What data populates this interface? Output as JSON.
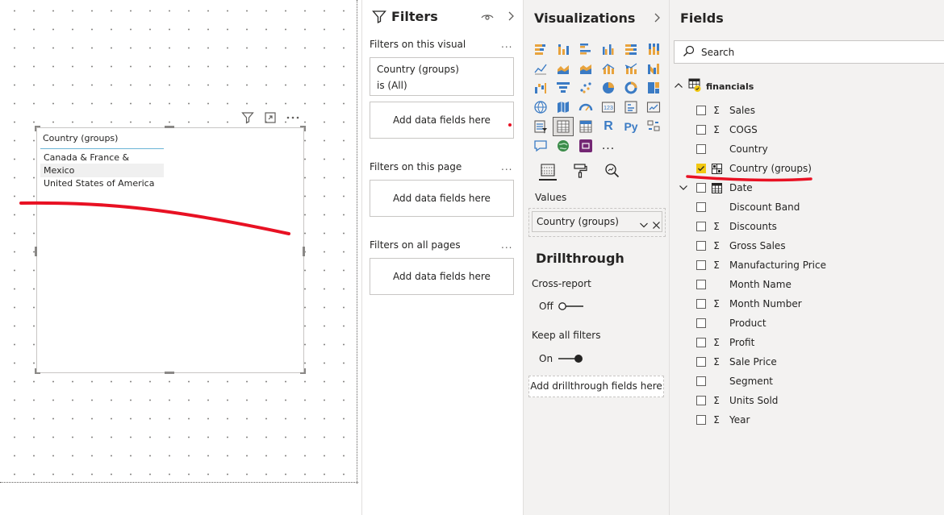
{
  "colors": {
    "accent_yellow": "#f2c811",
    "annotation_red": "#e81123",
    "pane_bg": "#f3f2f1",
    "border": "#c8c6c4"
  },
  "canvas": {
    "slicer": {
      "header": "Country (groups)",
      "items": [
        {
          "label": "Canada & France & Germany",
          "selected": false
        },
        {
          "label": "Mexico",
          "selected": true
        },
        {
          "label": "United States of America",
          "selected": false
        }
      ]
    },
    "visual_header_icons": [
      "filter-icon",
      "focus-mode-icon",
      "more-options-icon"
    ]
  },
  "filters": {
    "title": "Filters",
    "sections": {
      "visual": "Filters on this visual",
      "page": "Filters on this page",
      "all": "Filters on all pages"
    },
    "visual_filter": {
      "field": "Country (groups)",
      "condition": "is (All)"
    },
    "add_fields": "Add data fields here",
    "more": "..."
  },
  "visualizations": {
    "title": "Visualizations",
    "more": "...",
    "icons": [
      "stacked-bar-icon",
      "stacked-column-icon",
      "clustered-bar-icon",
      "clustered-column-icon",
      "100-stacked-bar-icon",
      "100-stacked-column-icon",
      "line-chart-icon",
      "area-chart-icon",
      "stacked-area-icon",
      "line-column-icon",
      "line-stacked-column-icon",
      "ribbon-chart-icon",
      "waterfall-icon",
      "funnel-icon",
      "scatter-icon",
      "pie-chart-icon",
      "donut-chart-icon",
      "treemap-icon",
      "map-icon",
      "filled-map-icon",
      "gauge-icon",
      "card-icon",
      "multi-row-card-icon",
      "kpi-icon",
      "slicer-icon",
      "table-icon",
      "matrix-icon",
      "r-visual-icon",
      "python-visual-icon",
      "key-influencers-icon",
      "qa-icon",
      "arcgis-icon",
      "power-apps-icon",
      "more-visuals-icon"
    ],
    "letter_icons": {
      "r": "R",
      "py": "Py"
    },
    "values_label": "Values",
    "values_field": "Country (groups)",
    "drillthrough_title": "Drillthrough",
    "cross_report_label": "Cross-report",
    "cross_report_state": "Off",
    "keep_filters_label": "Keep all filters",
    "keep_filters_state": "On",
    "drill_add": "Add drillthrough fields here"
  },
  "fields": {
    "title": "Fields",
    "search_placeholder": "Search",
    "table": "financials",
    "items": [
      {
        "name": "Sales",
        "type": "sigma",
        "checked": false
      },
      {
        "name": "COGS",
        "type": "sigma",
        "checked": false
      },
      {
        "name": "Country",
        "type": "none",
        "checked": false
      },
      {
        "name": "Country (groups)",
        "type": "group",
        "checked": true
      },
      {
        "name": "Date",
        "type": "calendar",
        "checked": false
      },
      {
        "name": "Discount Band",
        "type": "none",
        "checked": false
      },
      {
        "name": "Discounts",
        "type": "sigma",
        "checked": false
      },
      {
        "name": "Gross Sales",
        "type": "sigma",
        "checked": false
      },
      {
        "name": "Manufacturing Price",
        "type": "sigma",
        "checked": false
      },
      {
        "name": "Month Name",
        "type": "none",
        "checked": false
      },
      {
        "name": "Month Number",
        "type": "sigma",
        "checked": false
      },
      {
        "name": "Product",
        "type": "none",
        "checked": false
      },
      {
        "name": "Profit",
        "type": "sigma",
        "checked": false
      },
      {
        "name": "Sale Price",
        "type": "sigma",
        "checked": false
      },
      {
        "name": "Segment",
        "type": "none",
        "checked": false
      },
      {
        "name": "Units Sold",
        "type": "sigma",
        "checked": false
      },
      {
        "name": "Year",
        "type": "sigma",
        "checked": false
      }
    ],
    "sigma_glyph": "Σ"
  }
}
